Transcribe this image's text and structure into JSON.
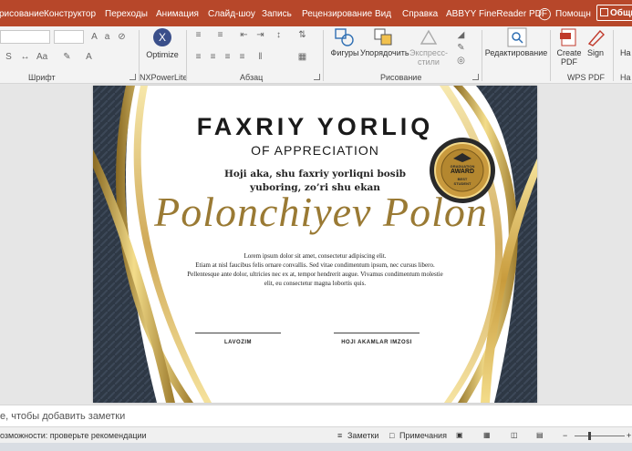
{
  "menu": {
    "items": [
      "рисование",
      "Конструктор",
      "Переходы",
      "Анимация",
      "Слайд-шоу",
      "Запись",
      "Рецензирование",
      "Вид",
      "Справка",
      "ABBYY FineReader PDF",
      "Помощн"
    ],
    "share": "Общи"
  },
  "ribbon": {
    "groups": {
      "font": "Шрифт",
      "nxpower": "NXPowerLite",
      "paragraph": "Абзац",
      "drawing": "Рисование",
      "wps": "WPS PDF"
    },
    "buttons": {
      "optimize": "Optimize",
      "shapes": "Фигуры",
      "arrange": "Упорядочить",
      "express": "Экспресс-стили",
      "editing": "Редактирование",
      "create_pdf": "Create PDF",
      "sign": "Sign",
      "last": "На"
    }
  },
  "slide": {
    "title": "FAXRIY YORLIQ",
    "subtitle": "OF APPRECIATION",
    "dedication_line1": "Hoji aka, shu faxriy yorliqni bosib",
    "dedication_line2": "yuboring, zo’ri shu ekan",
    "recipient": "Polonchiyev Polon",
    "lorem": [
      "Lorem ipsum dolor sit amet, consectetur adipiscing elit.",
      "Etiam at nisl faucibus felis ornare convallis.  Sed vitae condimentum ipsum, nec cursus libero.",
      "Pellentesque ante dolor, ultricies nec ex at, tempor hendrerit augue. Vivamus condimentum molestie",
      "elit, eu consectetur magna lobortis quis."
    ],
    "sig_left": "LAVOZIM",
    "sig_right": "HOJI AKAMLAR IMZOSI",
    "badge": {
      "top": "GRADUATION",
      "main": "AWARD",
      "line1": "BEST",
      "line2": "STUDENT"
    },
    "colors": {
      "gold": "#c9a24a",
      "dark_panel": "#2b3440",
      "script_gold": "#9a7a34"
    }
  },
  "notes": {
    "placeholder": "е, чтобы добавить заметки"
  },
  "status": {
    "accessibility": "озможности: проверьте рекомендации",
    "notes_btn": "Заметки",
    "comments_btn": "Примечания"
  }
}
